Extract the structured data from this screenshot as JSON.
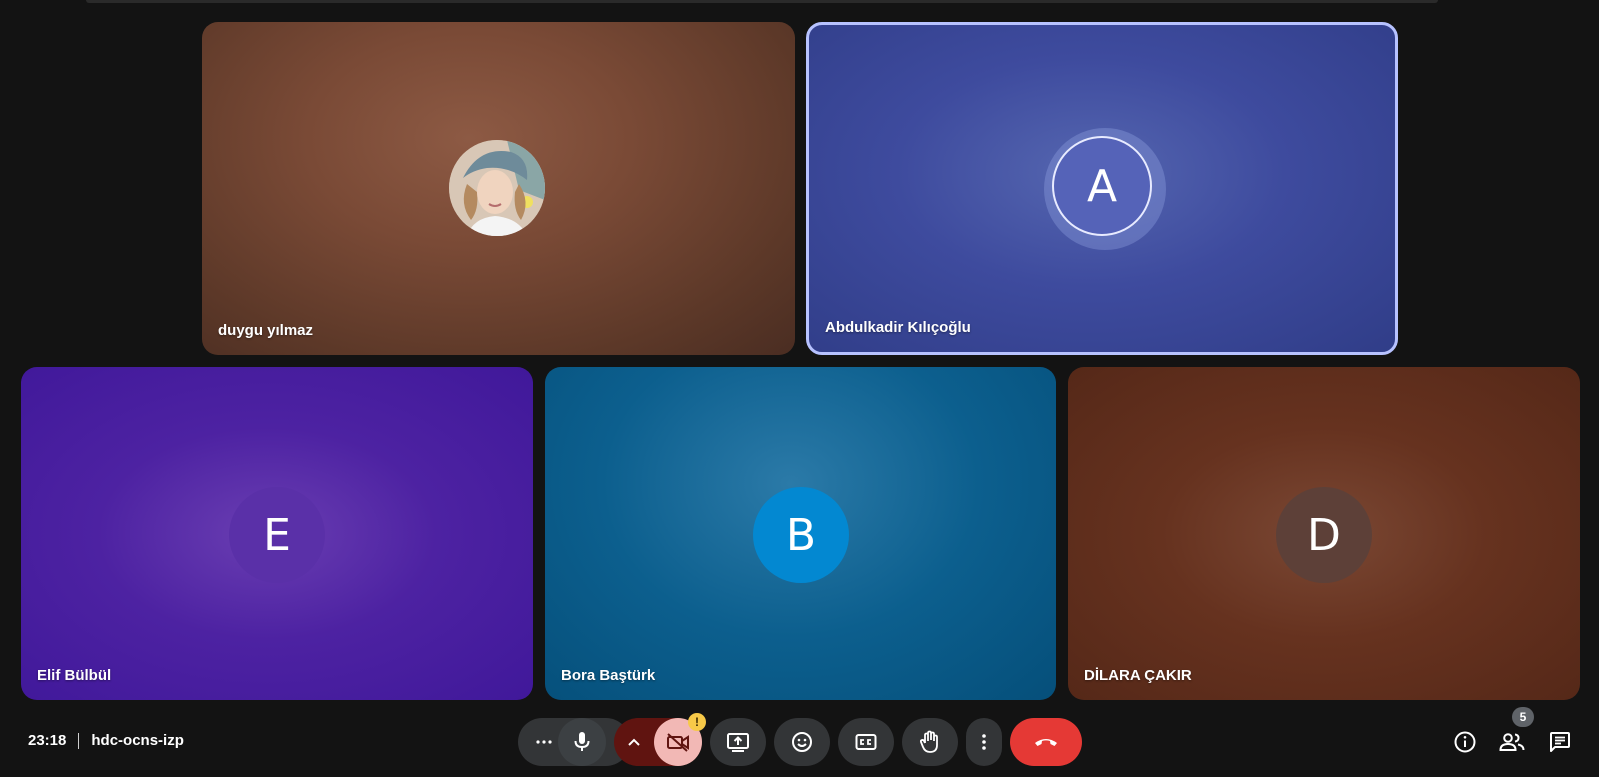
{
  "participants": [
    {
      "id": "duygu",
      "name": "duygu yılmaz",
      "initial": "",
      "avatar_type": "photo"
    },
    {
      "id": "abdulkadir",
      "name": "Abdulkadir Kılıçoğlu",
      "initial": "A",
      "avatar_color": "#5563b8",
      "active_speaker": true
    },
    {
      "id": "elif",
      "name": "Elif Bülbül",
      "initial": "E",
      "avatar_color": "#5a30a8"
    },
    {
      "id": "bora",
      "name": "Bora Baştürk",
      "initial": "B",
      "avatar_color": "#0388d1"
    },
    {
      "id": "dilara",
      "name": "DİLARA ÇAKIR",
      "initial": "D",
      "avatar_color": "#5d4038"
    }
  ],
  "meeting": {
    "time": "23:18",
    "code": "hdc-ocns-izp"
  },
  "controls": {
    "more_options_icon": "more-horiz-icon",
    "mic_icon": "mic-icon",
    "camera_options_icon": "chevron-up-icon",
    "camera_icon": "videocam-off-icon",
    "camera_warning": "!",
    "present_icon": "present-to-all-icon",
    "reactions_icon": "emoji-icon",
    "captions_icon": "closed-caption-icon",
    "raise_hand_icon": "hand-icon",
    "more_vert_icon": "more-vert-icon",
    "end_call_icon": "call-end-icon"
  },
  "side_panel": {
    "info_icon": "info-icon",
    "people_icon": "people-icon",
    "people_count": "5",
    "chat_icon": "chat-icon"
  },
  "colors": {
    "background": "#131313",
    "control": "#333537",
    "end_call": "#e53935",
    "camera_off": "#f2b8b5",
    "camera_options": "#601410",
    "active_border": "#b7c2ff",
    "warning": "#f7c948"
  }
}
